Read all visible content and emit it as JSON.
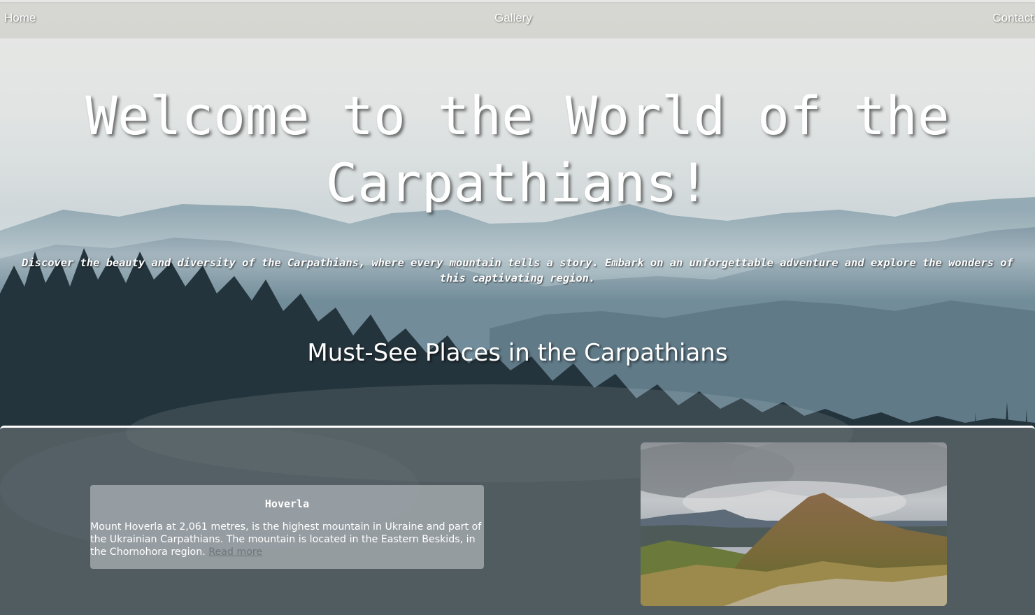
{
  "nav": {
    "home": "Home",
    "gallery": "Gallery",
    "contact": "Contact"
  },
  "hero": {
    "title": "Welcome to the World of the Carpathians!",
    "subtitle": "Discover the beauty and diversity of the Carpathians, where every mountain tells a story. Embark on an unforgettable adventure and explore the wonders of this captivating region."
  },
  "places": {
    "heading": "Must-See Places in the Carpathians",
    "items": [
      {
        "name": "Hoverla",
        "description": "Mount Hoverla at 2,061 metres, is the highest mountain in Ukraine and part of the Ukrainian Carpathians. The mountain is located in the Eastern Beskids, in the Chornohora region.",
        "link_text": "Read more",
        "photo": "mountain-peak-photo"
      }
    ]
  },
  "colors": {
    "text": "#ffffff",
    "nav_bg": "#d2d2ce",
    "section_bg": "#626c70",
    "link": "#6f7578"
  }
}
